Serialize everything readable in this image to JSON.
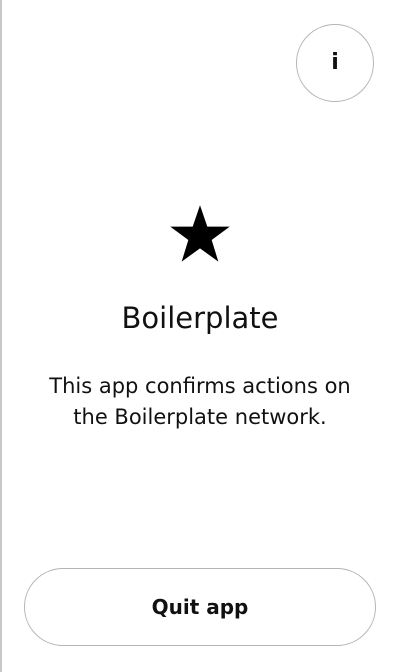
{
  "header": {
    "info_button": {
      "label": "i",
      "icon": "info-icon"
    }
  },
  "app": {
    "icon": "star-icon",
    "name": "Boilerplate",
    "description": "This app confirms actions on the Boilerplate network."
  },
  "footer": {
    "quit_label": "Quit app"
  },
  "colors": {
    "background": "#ffffff",
    "text": "#111111",
    "border": "#b5b5b5"
  }
}
